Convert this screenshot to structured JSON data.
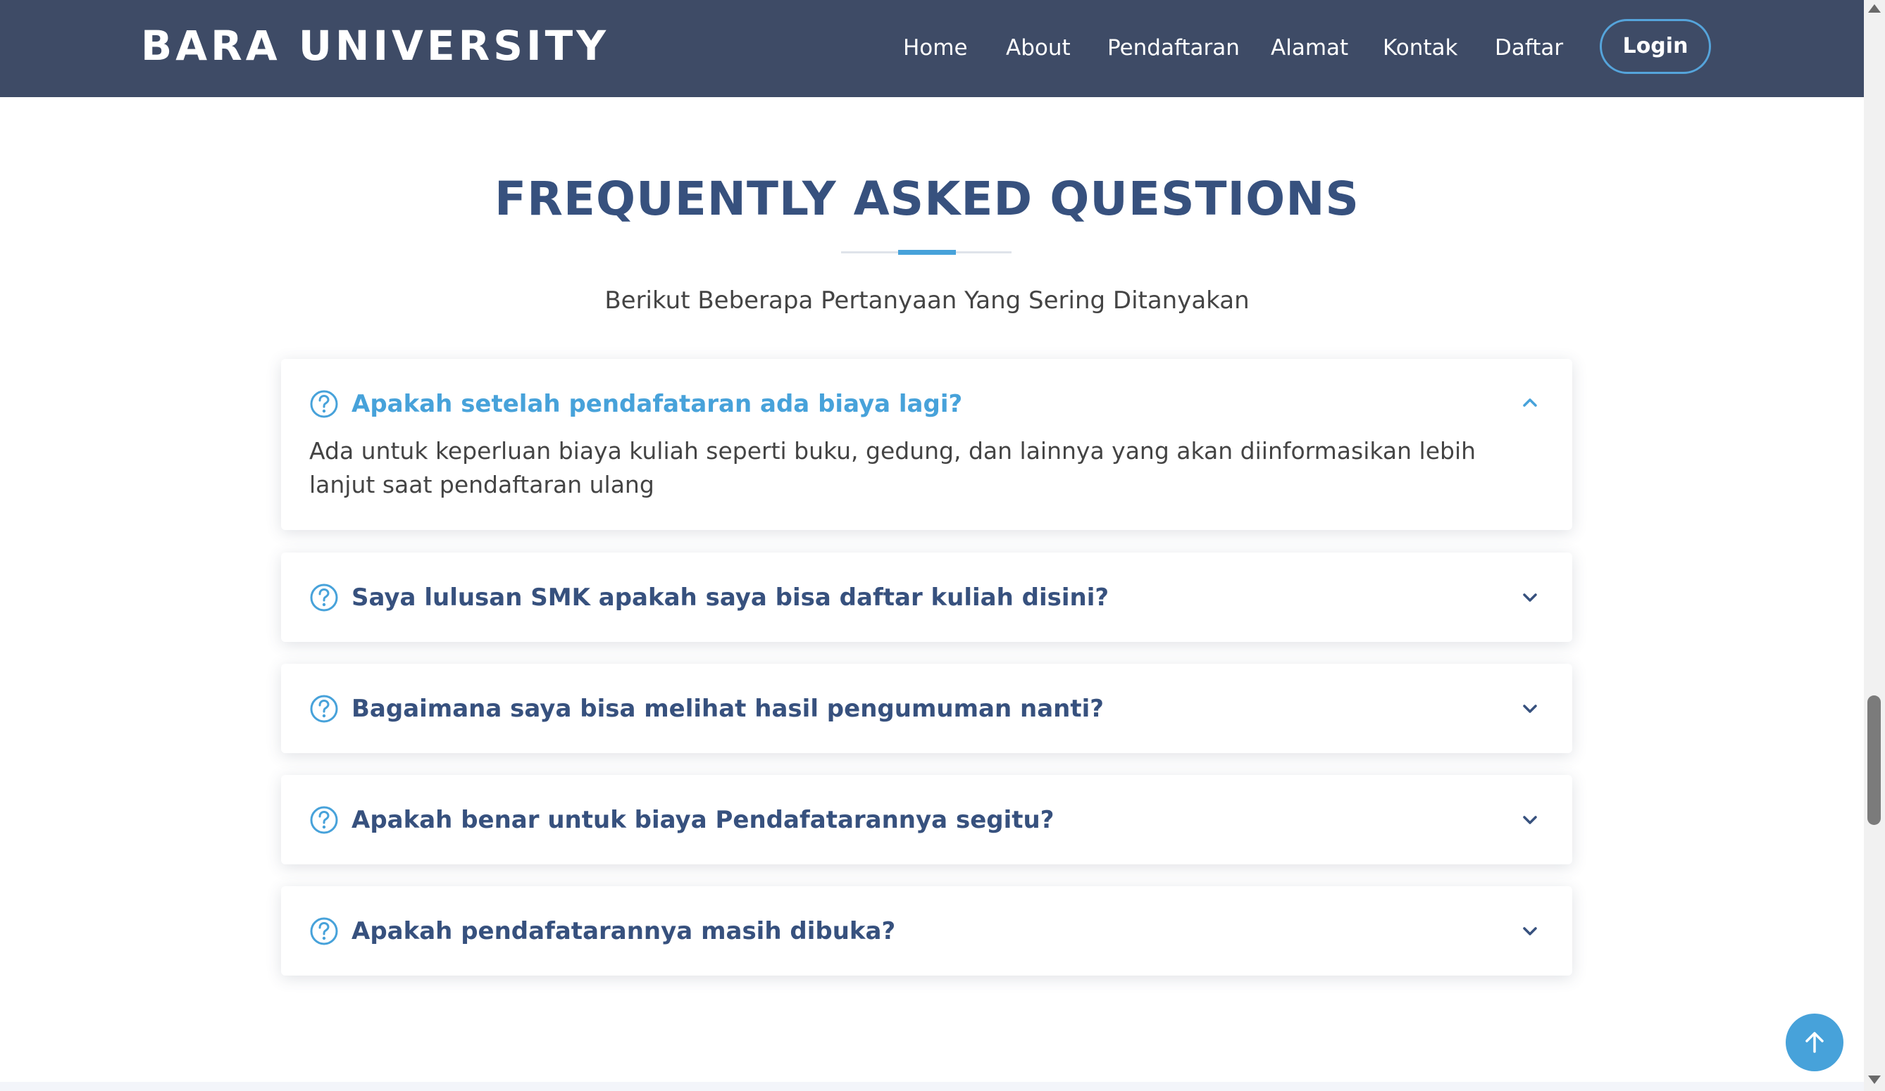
{
  "header": {
    "brand": "BARA UNIVERSITY",
    "nav": [
      "Home",
      "About",
      "Pendaftaran",
      "Alamat",
      "Kontak",
      "Daftar"
    ],
    "login_label": "Login"
  },
  "faq": {
    "title": "FREQUENTLY ASKED QUESTIONS",
    "subtitle": "Berikut Beberapa Pertanyaan Yang Sering Ditanyakan",
    "items": [
      {
        "question": "Apakah setelah pendafataran ada biaya lagi?",
        "answer": "Ada untuk keperluan biaya kuliah seperti buku, gedung, dan lainnya yang akan diinformasikan lebih lanjut saat pendaftaran ulang",
        "expanded": true
      },
      {
        "question": "Saya lulusan SMK apakah saya bisa daftar kuliah disini?",
        "expanded": false
      },
      {
        "question": "Bagaimana saya bisa melihat hasil pengumuman nanti?",
        "expanded": false
      },
      {
        "question": "Apakah benar untuk biaya Pendafatarannya segitu?",
        "expanded": false
      },
      {
        "question": "Apakah pendafatarannya masih dibuka?",
        "expanded": false
      }
    ]
  },
  "icons": {
    "question": "question-circle-icon",
    "chevron_up": "chevron-up-icon",
    "chevron_down": "chevron-down-icon",
    "back_to_top": "arrow-up-icon"
  },
  "colors": {
    "header_bg": "#3e4b66",
    "heading": "#37517e",
    "accent": "#47a2da",
    "body_text": "#444444"
  }
}
